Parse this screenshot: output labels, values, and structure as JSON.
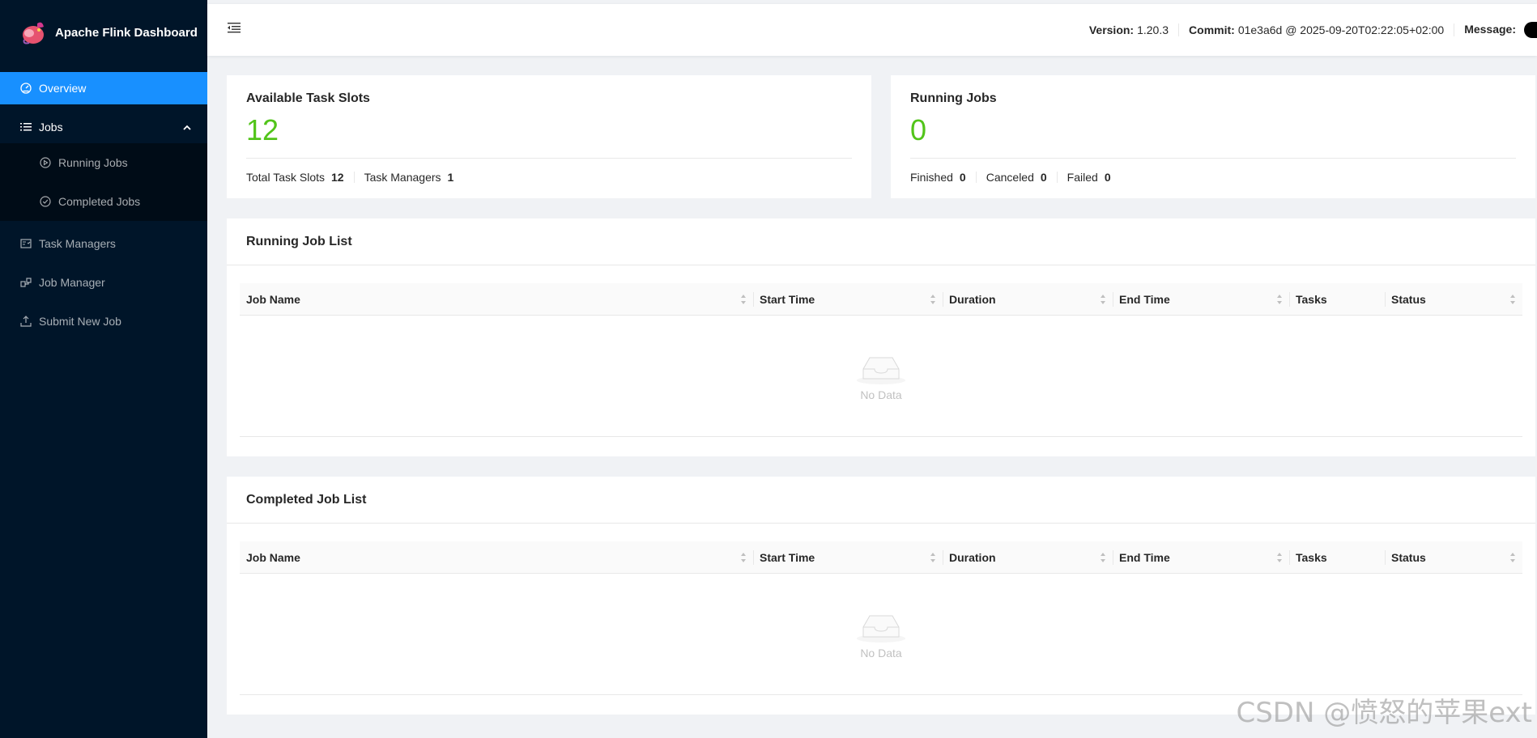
{
  "app": {
    "title": "Apache Flink Dashboard"
  },
  "sidebar": {
    "items": [
      {
        "label": "Overview",
        "icon": "dashboard-icon"
      },
      {
        "label": "Jobs",
        "icon": "list-icon"
      },
      {
        "label": "Running Jobs",
        "icon": "play-circle-icon"
      },
      {
        "label": "Completed Jobs",
        "icon": "check-circle-icon"
      },
      {
        "label": "Task Managers",
        "icon": "schedule-icon"
      },
      {
        "label": "Job Manager",
        "icon": "cluster-icon"
      },
      {
        "label": "Submit New Job",
        "icon": "upload-icon"
      }
    ]
  },
  "header": {
    "version_label": "Version:",
    "version": "1.20.3",
    "commit_label": "Commit:",
    "commit": "01e3a6d @ 2025-09-20T02:22:05+02:00",
    "message_label": "Message:"
  },
  "slots": {
    "title": "Available Task Slots",
    "value": "12",
    "total_label": "Total Task Slots",
    "total": "12",
    "tm_label": "Task Managers",
    "tm": "1"
  },
  "running": {
    "title": "Running Jobs",
    "value": "0",
    "finished_label": "Finished",
    "finished": "0",
    "canceled_label": "Canceled",
    "canceled": "0",
    "failed_label": "Failed",
    "failed": "0"
  },
  "running_list": {
    "title": "Running Job List",
    "empty": "No Data"
  },
  "completed_list": {
    "title": "Completed Job List",
    "empty": "No Data"
  },
  "columns": [
    "Job Name",
    "Start Time",
    "Duration",
    "End Time",
    "Tasks",
    "Status"
  ],
  "watermark": "CSDN @愤怒的苹果ext",
  "colors": {
    "sider": "#001529",
    "active": "#1890ff",
    "green": "#52c41a"
  }
}
